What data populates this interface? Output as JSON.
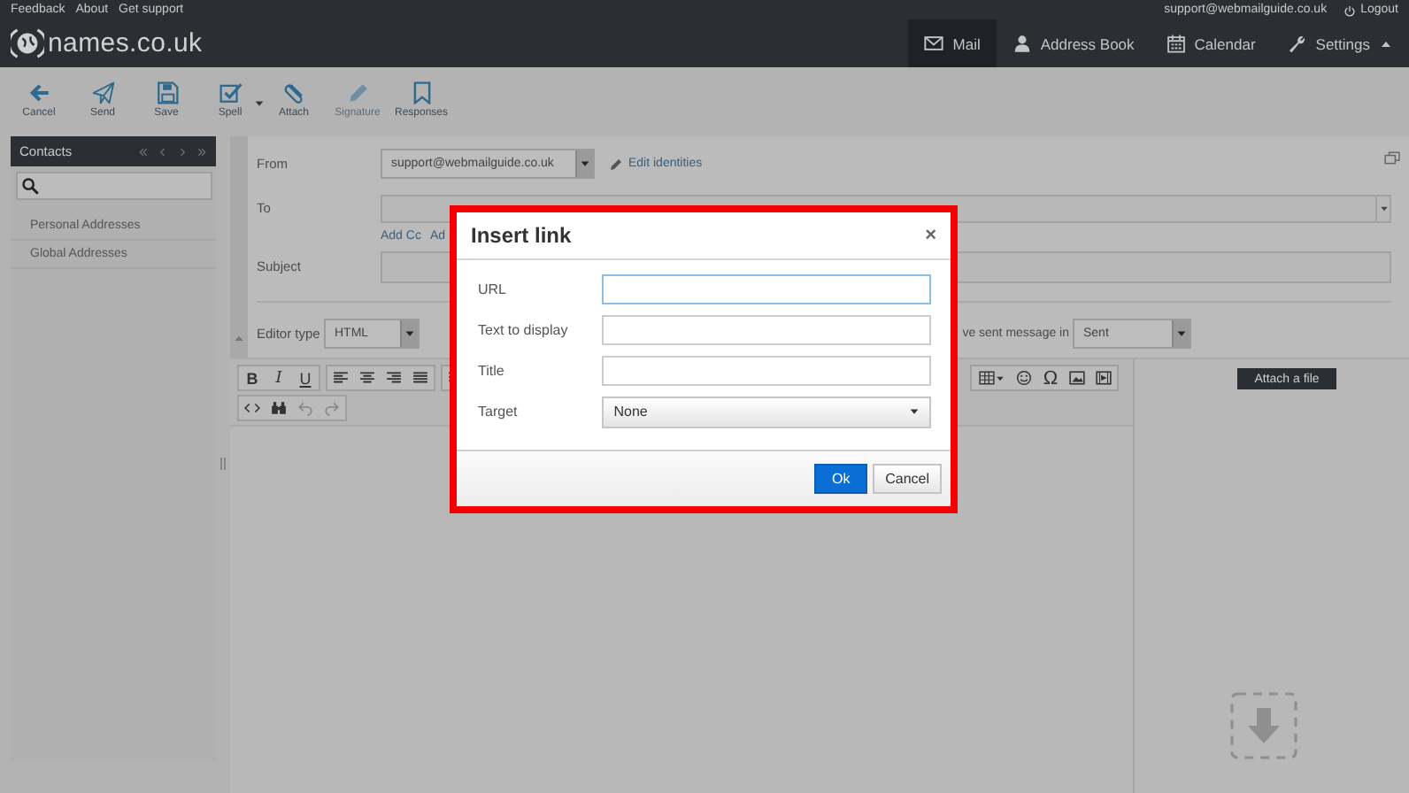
{
  "top_links": [
    {
      "label": "Feedback"
    },
    {
      "label": "About"
    },
    {
      "label": "Get support"
    }
  ],
  "logo": {
    "text": "names.co.uk"
  },
  "account": {
    "email": "support@webmailguide.co.uk",
    "logout": "Logout"
  },
  "nav": [
    {
      "label": "Mail",
      "kind": "mail",
      "selected": true,
      "dropdown": false
    },
    {
      "label": "Address Book",
      "kind": "person",
      "selected": false,
      "dropdown": false
    },
    {
      "label": "Calendar",
      "kind": "calendar",
      "selected": false,
      "dropdown": false
    },
    {
      "label": "Settings",
      "kind": "wrench",
      "selected": false,
      "dropdown": true
    }
  ],
  "toolbar": [
    {
      "label": "Cancel",
      "kind": "back",
      "disabled": false,
      "dropdown": false
    },
    {
      "label": "Send",
      "kind": "send",
      "disabled": false,
      "dropdown": false
    },
    {
      "label": "Save",
      "kind": "save",
      "disabled": false,
      "dropdown": false
    },
    {
      "label": "Spell",
      "kind": "check",
      "disabled": false,
      "dropdown": true
    },
    {
      "label": "Attach",
      "kind": "clip",
      "disabled": false,
      "dropdown": false
    },
    {
      "label": "Signature",
      "kind": "pencil",
      "disabled": true,
      "dropdown": false
    },
    {
      "label": "Responses",
      "kind": "bookmark",
      "disabled": false,
      "dropdown": false
    }
  ],
  "contacts": {
    "title": "Contacts",
    "groups": [
      {
        "label": "Personal Addresses"
      },
      {
        "label": "Global Addresses"
      }
    ]
  },
  "compose": {
    "from": {
      "label": "From",
      "value": "support@webmailguide.co.uk"
    },
    "edit_identities": "Edit identities",
    "to": {
      "label": "To"
    },
    "add_links": [
      {
        "label": "Add Cc"
      },
      {
        "label": "Ad"
      }
    ],
    "subject": {
      "label": "Subject"
    },
    "editor_type": {
      "label": "Editor type",
      "value": "HTML"
    },
    "save_sent": {
      "label": "ve sent message in",
      "value": "Sent"
    },
    "attach_button": "Attach a file"
  },
  "editor_toolbar": {
    "row_1_left": [
      [
        {
          "kind": "bold",
          "text": "B"
        },
        {
          "kind": "italic",
          "text": "I"
        },
        {
          "kind": "underline",
          "text": "U"
        }
      ],
      [
        {
          "kind": "align-left"
        },
        {
          "kind": "align-center"
        },
        {
          "kind": "align-right"
        },
        {
          "kind": "justify"
        }
      ],
      [
        {
          "kind": "list"
        }
      ]
    ],
    "row_1_right": [
      [
        {
          "kind": "table"
        },
        {
          "kind": "smiley"
        },
        {
          "kind": "omega",
          "text": "Ω"
        },
        {
          "kind": "image"
        },
        {
          "kind": "media"
        }
      ]
    ],
    "row_2": [
      [
        {
          "kind": "code"
        },
        {
          "kind": "binoculars"
        },
        {
          "kind": "undo"
        },
        {
          "kind": "redo"
        }
      ]
    ]
  },
  "dialog": {
    "title": "Insert link",
    "close": "×",
    "fields": [
      {
        "label": "URL",
        "kind": "text",
        "focused": true
      },
      {
        "label": "Text to display",
        "kind": "text",
        "focused": false
      },
      {
        "label": "Title",
        "kind": "text",
        "focused": false
      },
      {
        "label": "Target",
        "kind": "select",
        "value": "None",
        "focused": false
      }
    ],
    "buttons": [
      {
        "label": "Ok",
        "primary": true
      },
      {
        "label": "Cancel",
        "primary": false
      }
    ]
  }
}
